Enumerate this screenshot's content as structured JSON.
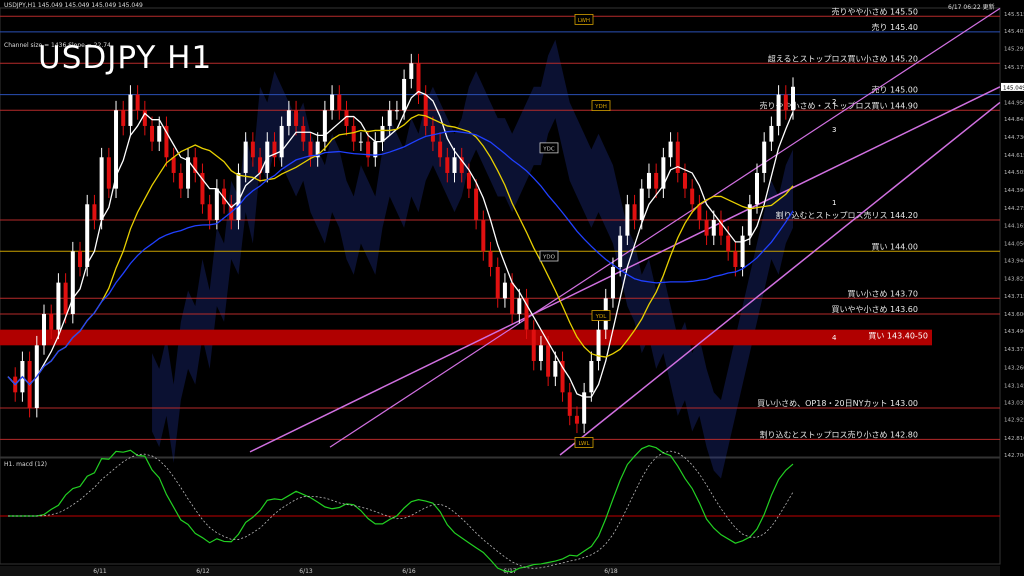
{
  "header": {
    "symbol_line": "USDJPY,H1  145.049 145.049 145.049 145.049",
    "timestamp": "6/17 06:22 更新",
    "channel_info": "Channel size = 1436 Slope = 22.74",
    "big_title": "USDJPY H1",
    "sub_indicator_label": "H1. macd (12)"
  },
  "chart_data": {
    "type": "line",
    "title": "USDJPY H1",
    "price_axis": {
      "ylim": [
        142.7,
        145.54
      ],
      "ticks": [
        "145.515",
        "145.405",
        "145.295",
        "145.175",
        "145.049",
        "144.950",
        "144.845",
        "144.730",
        "144.615",
        "144.505",
        "144.390",
        "144.275",
        "144.165",
        "144.050",
        "143.940",
        "143.825",
        "143.715",
        "143.600",
        "143.490",
        "143.375",
        "143.260",
        "143.145",
        "143.035",
        "142.925",
        "142.810",
        "142.700"
      ]
    },
    "current_price": "145.049",
    "x_axis": {
      "labels": [
        "6/11",
        "6/12",
        "6/13",
        "6/16",
        "6/17",
        "6/18"
      ]
    },
    "levels": [
      {
        "price": 145.5,
        "label": "売りやや小さめ 145.50",
        "color": "#b52a2a"
      },
      {
        "price": 145.4,
        "label": "売り 145.40",
        "color": "#2a4fb5"
      },
      {
        "price": 145.2,
        "label": "超えるとストップロス買い小さめ 145.20",
        "color": "#b52a2a"
      },
      {
        "price": 145.0,
        "label": "売り 145.00",
        "color": "#2a4fb5"
      },
      {
        "price": 144.9,
        "label": "売りやや小さめ・ストップロス買い 144.90",
        "color": "#b52a2a"
      },
      {
        "price": 144.2,
        "label": "割り込むとストップロス売リス 144.20",
        "color": "#b52a2a"
      },
      {
        "price": 144.0,
        "label": "買い 144.00",
        "color": "#c8a000"
      },
      {
        "price": 143.7,
        "label": "買い小さめ 143.70",
        "color": "#b52a2a"
      },
      {
        "price": 143.6,
        "label": "買いやや小さめ 143.60",
        "color": "#b52a2a"
      },
      {
        "price": 143.45,
        "label": "買い 143.40-50",
        "color": "#c00000",
        "zone": [
          143.4,
          143.5
        ]
      },
      {
        "price": 143.0,
        "label": "買い小さめ、OP18・20日NYカット 143.00",
        "color": "#b52a2a"
      },
      {
        "price": 142.8,
        "label": "割り込むとストップロス売り小さめ 142.80",
        "color": "#b52a2a"
      }
    ],
    "tags": [
      {
        "text": "LWH",
        "price": 145.48,
        "color": "#d4a000"
      },
      {
        "text": "YDH",
        "price": 144.93,
        "color": "#d4a000"
      },
      {
        "text": "YDC",
        "price": 144.66,
        "color": "#cccccc"
      },
      {
        "text": "YDO",
        "price": 143.97,
        "color": "#cccccc"
      },
      {
        "text": "YDL",
        "price": 143.59,
        "color": "#d4a000"
      },
      {
        "text": "LWL",
        "price": 142.78,
        "color": "#d4a000"
      }
    ],
    "wave_labels": [
      "1",
      "2",
      "3",
      "4"
    ],
    "close_series": [
      143.2,
      143.1,
      143.3,
      143.0,
      143.4,
      143.6,
      143.5,
      143.8,
      143.6,
      144.0,
      143.9,
      144.3,
      144.2,
      144.6,
      144.4,
      144.9,
      144.8,
      145.0,
      144.9,
      144.8,
      144.7,
      144.8,
      144.6,
      144.5,
      144.4,
      144.6,
      144.5,
      144.3,
      144.2,
      144.4,
      144.3,
      144.2,
      144.5,
      144.7,
      144.6,
      144.5,
      144.7,
      144.6,
      144.8,
      144.9,
      144.8,
      144.7,
      144.6,
      144.7,
      144.9,
      145.0,
      144.9,
      144.8,
      144.7,
      144.7,
      144.6,
      144.7,
      144.8,
      144.9,
      144.9,
      145.1,
      145.2,
      145.0,
      144.8,
      144.7,
      144.6,
      144.5,
      144.6,
      144.5,
      144.4,
      144.2,
      144.0,
      143.9,
      143.7,
      143.8,
      143.6,
      143.7,
      143.5,
      143.3,
      143.4,
      143.2,
      143.3,
      143.1,
      142.95,
      142.9,
      143.1,
      143.3,
      143.5,
      143.7,
      143.9,
      144.1,
      144.3,
      144.2,
      144.4,
      144.5,
      144.4,
      144.6,
      144.7,
      144.5,
      144.4,
      144.3,
      144.2,
      144.1,
      144.2,
      144.1,
      144.0,
      143.9,
      144.1,
      144.3,
      144.5,
      144.7,
      144.8,
      145.0,
      144.9,
      145.05
    ]
  }
}
